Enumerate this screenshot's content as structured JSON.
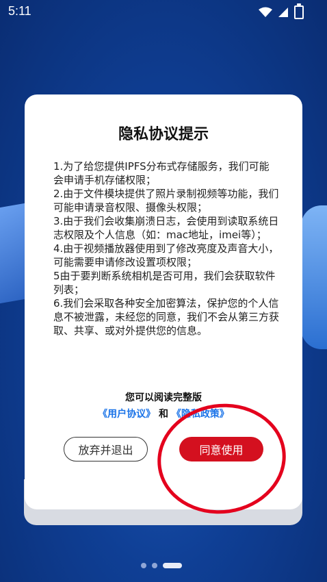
{
  "status_bar": {
    "time": "5:11"
  },
  "dialog": {
    "title": "隐私协议提示",
    "terms": [
      "1.为了给您提供IPFS分布式存储服务，我们可能会申请手机存储权限；",
      "2.由于文件模块提供了照片录制视频等功能，我们可能申请录音权限、摄像头权限；",
      "3.由于我们会收集崩溃日志，会使用到读取系统日志权限及个人信息（如：mac地址，imei等）；",
      " 4.由于视频播放器使用到了修改亮度及声音大小，可能需要申请修改设置项权限；",
      "5由于要判断系统相机是否可用，我们会获取软件列表；",
      "6.我们会采取各种安全加密算法，保护您的个人信息不被泄露，未经您的同意，我们不会从第三方获取、共享、或对外提供您的信息。"
    ],
    "read_full": "您可以阅读完整版",
    "user_agreement": "《用户协议》",
    "and": "和",
    "privacy_policy": "《隐私政策》",
    "reject_label": "放弃并退出",
    "agree_label": "同意使用"
  },
  "colors": {
    "accent": "#d4101f",
    "link": "#1a73e8",
    "annotation": "#e4001d"
  },
  "icons": [
    "wifi-icon",
    "signal-icon",
    "battery-icon"
  ]
}
